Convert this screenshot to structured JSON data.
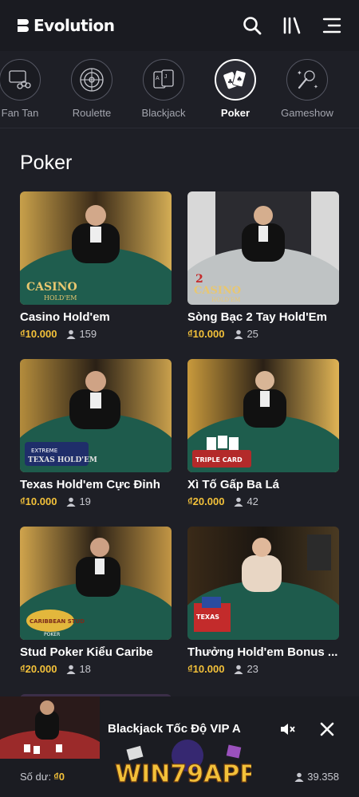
{
  "header": {
    "brand": "Evolution",
    "icons": [
      "search-icon",
      "library-icon",
      "menu-icon"
    ]
  },
  "categories": [
    {
      "label": "Fan Tan",
      "icon": "fan-tan-icon",
      "active": false
    },
    {
      "label": "Roulette",
      "icon": "roulette-icon",
      "active": false
    },
    {
      "label": "Blackjack",
      "icon": "blackjack-icon",
      "active": false
    },
    {
      "label": "Poker",
      "icon": "poker-icon",
      "active": true
    },
    {
      "label": "Gameshow",
      "icon": "gameshow-icon",
      "active": false
    }
  ],
  "section": {
    "title": "Poker"
  },
  "games": [
    {
      "title": "Casino Hold'em",
      "bet": "₫10.000",
      "players": "159",
      "logo": "CASINO HOLD'EM"
    },
    {
      "title": "Sòng Bạc 2 Tay Hold'Em",
      "bet": "₫10.000",
      "players": "25",
      "logo": "2 HAND CASINO HOLD'EM"
    },
    {
      "title": "Texas Hold'em Cực Đỉnh",
      "bet": "₫10.000",
      "players": "19",
      "logo": "EXTREME TEXAS HOLD'EM"
    },
    {
      "title": "Xì Tố Gấp Ba Lá",
      "bet": "₫20.000",
      "players": "42",
      "logo": "TRIPLE CARD POKER"
    },
    {
      "title": "Stud Poker Kiểu Caribe",
      "bet": "₫20.000",
      "players": "18",
      "logo": "CARIBBEAN STUD POKER"
    },
    {
      "title": "Thưởng Hold'em Bonus ...",
      "bet": "₫10.000",
      "players": "23",
      "logo": "TEXAS HOLD'EM BONUS"
    }
  ],
  "mini_player": {
    "title": "Blackjack Tốc Độ VIP A",
    "balance_label": "Số dư:",
    "balance_value": "₫0",
    "total_players": "39.358",
    "watermark": "WIN79APP"
  },
  "colors": {
    "background": "#1e1f26",
    "accent_gold": "#f3c13a",
    "table_green": "#1f5d4e"
  }
}
